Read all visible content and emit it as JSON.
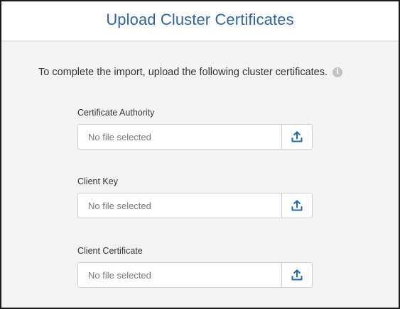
{
  "dialog": {
    "title": "Upload Cluster Certificates",
    "intro": "To complete the import, upload the following cluster certificates.",
    "info_icon_glyph": "i"
  },
  "fields": [
    {
      "label": "Certificate Authority",
      "value": "No file selected",
      "icon": "upload-icon"
    },
    {
      "label": "Client Key",
      "value": "No file selected",
      "icon": "upload-icon"
    },
    {
      "label": "Client Certificate",
      "value": "No file selected",
      "icon": "upload-icon"
    }
  ],
  "colors": {
    "title": "#2d64a6",
    "upload_icon": "#1f6bb0",
    "body_background": "#f4f4f4",
    "info_icon": "#c2c2c2"
  }
}
